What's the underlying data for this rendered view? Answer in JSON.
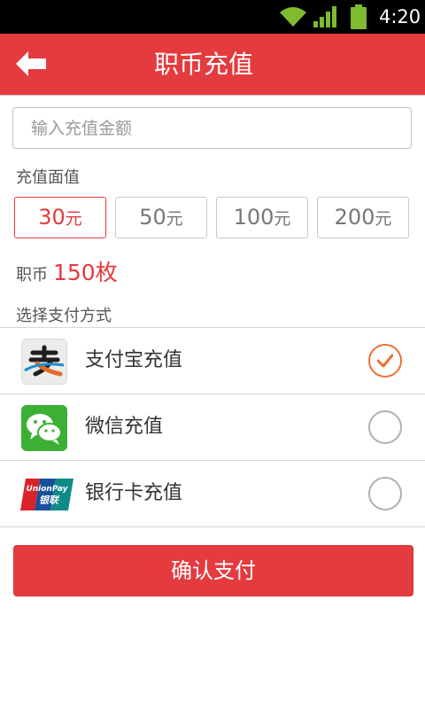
{
  "status_bar": {
    "time": "4:20",
    "icons": [
      "wifi-icon",
      "signal-icon",
      "battery-icon"
    ]
  },
  "header": {
    "title": "职币充值",
    "back_icon": "back-arrow-icon"
  },
  "amount_input": {
    "placeholder": "输入充值金额",
    "value": ""
  },
  "face_value": {
    "label": "充值面值",
    "options": [
      {
        "amount": "30",
        "unit": "元",
        "selected": true
      },
      {
        "amount": "50",
        "unit": "元",
        "selected": false
      },
      {
        "amount": "100",
        "unit": "元",
        "selected": false
      },
      {
        "amount": "200",
        "unit": "元",
        "selected": false
      }
    ]
  },
  "coins": {
    "label": "职币",
    "value": "150枚"
  },
  "payment": {
    "label": "选择支付方式",
    "methods": [
      {
        "label": "支付宝充值",
        "icon": "alipay-icon",
        "checked": true
      },
      {
        "label": "微信充值",
        "icon": "wechat-icon",
        "checked": false
      },
      {
        "label": "银行卡充值",
        "icon": "unionpay-icon",
        "checked": false
      }
    ]
  },
  "unionpay_logo": {
    "line1": "UnionPay",
    "line2": "银联"
  },
  "confirm_button": {
    "label": "确认支付"
  },
  "colors": {
    "brand_red": "#e43b3f",
    "check_orange": "#ef6f35",
    "wechat_green": "#3cb034"
  }
}
